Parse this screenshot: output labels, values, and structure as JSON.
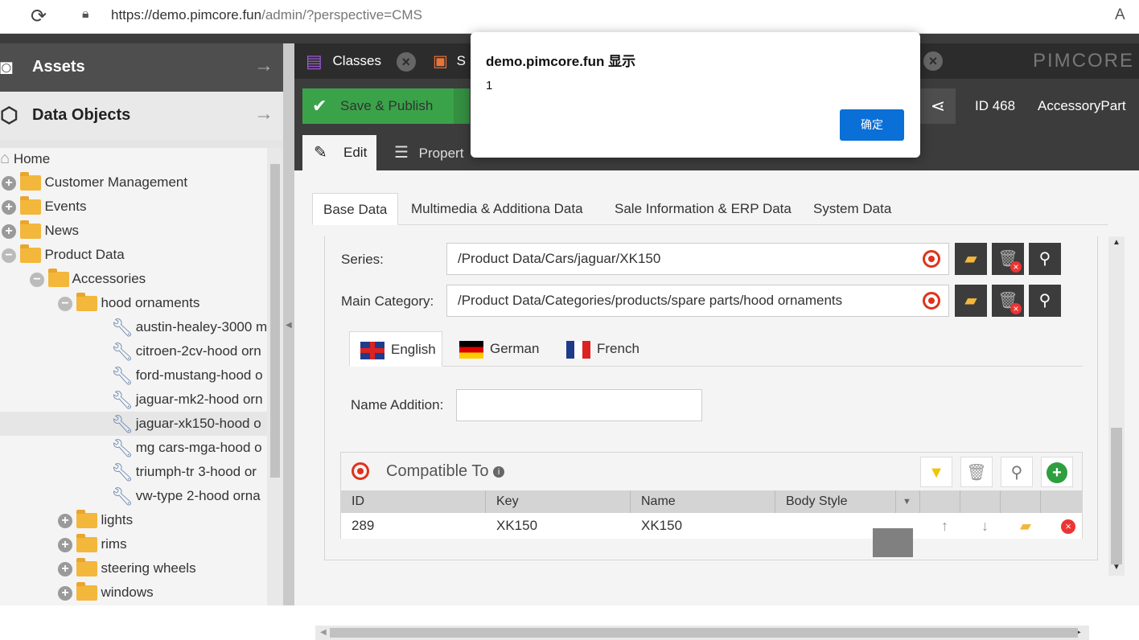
{
  "browser": {
    "url_host": "https://demo.pimcore.fun",
    "url_path": "/admin/?perspective=CMS"
  },
  "sidebar": {
    "assets_label": "Assets",
    "data_objects_label": "Data Objects",
    "tree": [
      {
        "label": "Home"
      },
      {
        "label": "Customer Management"
      },
      {
        "label": "Events"
      },
      {
        "label": "News"
      },
      {
        "label": "Product Data"
      },
      {
        "label": "Accessories"
      },
      {
        "label": "hood ornaments"
      },
      {
        "label": "austin-healey-3000 m"
      },
      {
        "label": "citroen-2cv-hood orn"
      },
      {
        "label": "ford-mustang-hood o"
      },
      {
        "label": "jaguar-mk2-hood orn"
      },
      {
        "label": "jaguar-xk150-hood o"
      },
      {
        "label": "mg cars-mga-hood o"
      },
      {
        "label": "triumph-tr 3-hood or"
      },
      {
        "label": "vw-type 2-hood orna"
      },
      {
        "label": "lights"
      },
      {
        "label": "rims"
      },
      {
        "label": "steering wheels"
      },
      {
        "label": "windows"
      }
    ]
  },
  "tabs": {
    "classes": "Classes",
    "second": "S",
    "logo": "PIMCORE"
  },
  "toolbar": {
    "save_publish": "Save & Publish",
    "id": "ID 468",
    "class_name": "AccessoryPart"
  },
  "edit_tabs": {
    "edit": "Edit",
    "properties": "Propert"
  },
  "sub_tabs": [
    "Base Data",
    "Multimedia & Additiona Data",
    "Sale Information & ERP Data",
    "System Data"
  ],
  "form": {
    "series_label": "Series:",
    "series_value": "/Product Data/Cars/jaguar/XK150",
    "main_category_label": "Main Category:",
    "main_category_value": "/Product Data/Categories/products/spare parts/hood ornaments",
    "languages": [
      "English",
      "German",
      "French"
    ],
    "name_addition_label": "Name Addition:"
  },
  "compatible": {
    "title": "Compatible To",
    "columns": [
      "ID",
      "Key",
      "Name",
      "Body Style"
    ],
    "rows": [
      {
        "id": "289",
        "key": "XK150",
        "name": "XK150",
        "body_style": ""
      }
    ]
  },
  "dialog": {
    "title": "demo.pimcore.fun 显示",
    "message": "1",
    "ok": "确定"
  }
}
